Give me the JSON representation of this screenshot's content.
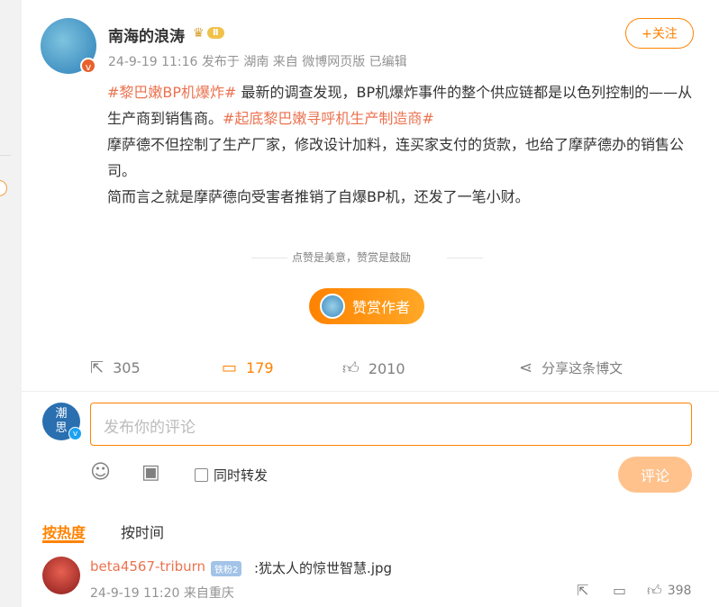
{
  "post": {
    "username": "南海的浪涛",
    "level": "Ⅱ",
    "meta": "24-9-19 11:16  发布于 湖南  来自 微博网页版  已编辑",
    "follow_label": "+关注",
    "tag1": "#黎巴嫩BP机爆炸#",
    "text1": " 最新的调查发现，BP机爆炸事件的整个供应链都是以色列控制的——从生产商到销售商。",
    "tag2": "#起底黎巴嫩寻呼机生产制造商#",
    "text2": "摩萨德不但控制了生产厂家，修改设计加料，连买家支付的货款，也给了摩萨德办的销售公司。",
    "text3": "简而言之就是摩萨德向受害者推销了自爆BP机，还发了一笔小财。",
    "divider_text": "点赞是美意，赞赏是鼓励",
    "reward_label": "赞赏作者"
  },
  "actions": {
    "repost": "305",
    "comment": "179",
    "like": "2010",
    "share": "分享这条博文"
  },
  "composer": {
    "avatar_text1": "潮",
    "avatar_text2": "思",
    "placeholder": "发布你的评论",
    "sync_label": "同时转发",
    "submit_label": "评论"
  },
  "sort": {
    "hot": "按热度",
    "time": "按时间"
  },
  "comments": [
    {
      "user": "beta4567-triburn",
      "badge": "铁粉2",
      "text": ":犹太人的惊世智慧.jpg",
      "time": "24-9-19 11:20  来自重庆",
      "likes": "398"
    }
  ],
  "colors": {
    "accent": "#ff8200",
    "tag": "#eb7350"
  }
}
